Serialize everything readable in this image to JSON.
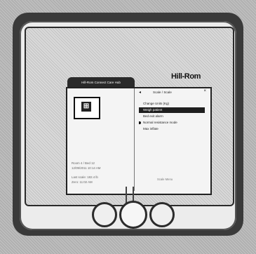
{
  "device": {
    "brand": "Hill-Rom"
  },
  "app": {
    "tab_title": "Hill-Rom Connect Care Hub"
  },
  "left_panel": {
    "icon": "patient-card-icon",
    "info_lines": [
      "Room 4 / Bed 12",
      "12/09/2011 10:14 AM"
    ],
    "extra_lines": [
      "Last scale: 182.4 lb",
      "Zero: 11:02 AM"
    ]
  },
  "menu": {
    "header_label": "Scale / Scale",
    "items": [
      {
        "label": "Change Units (Kg)",
        "selected": false,
        "bullet": false
      },
      {
        "label": "Weigh patient",
        "selected": true,
        "bullet": false
      },
      {
        "label": "Bed exit alarm",
        "selected": false,
        "bullet": false
      },
      {
        "label": "Normal resistance mode",
        "selected": false,
        "bullet": true
      },
      {
        "label": "Max inflate",
        "selected": false,
        "bullet": false
      }
    ],
    "footer": "Scale Menu"
  },
  "buttons": [
    "left-nav-button",
    "select-button",
    "right-nav-button"
  ]
}
